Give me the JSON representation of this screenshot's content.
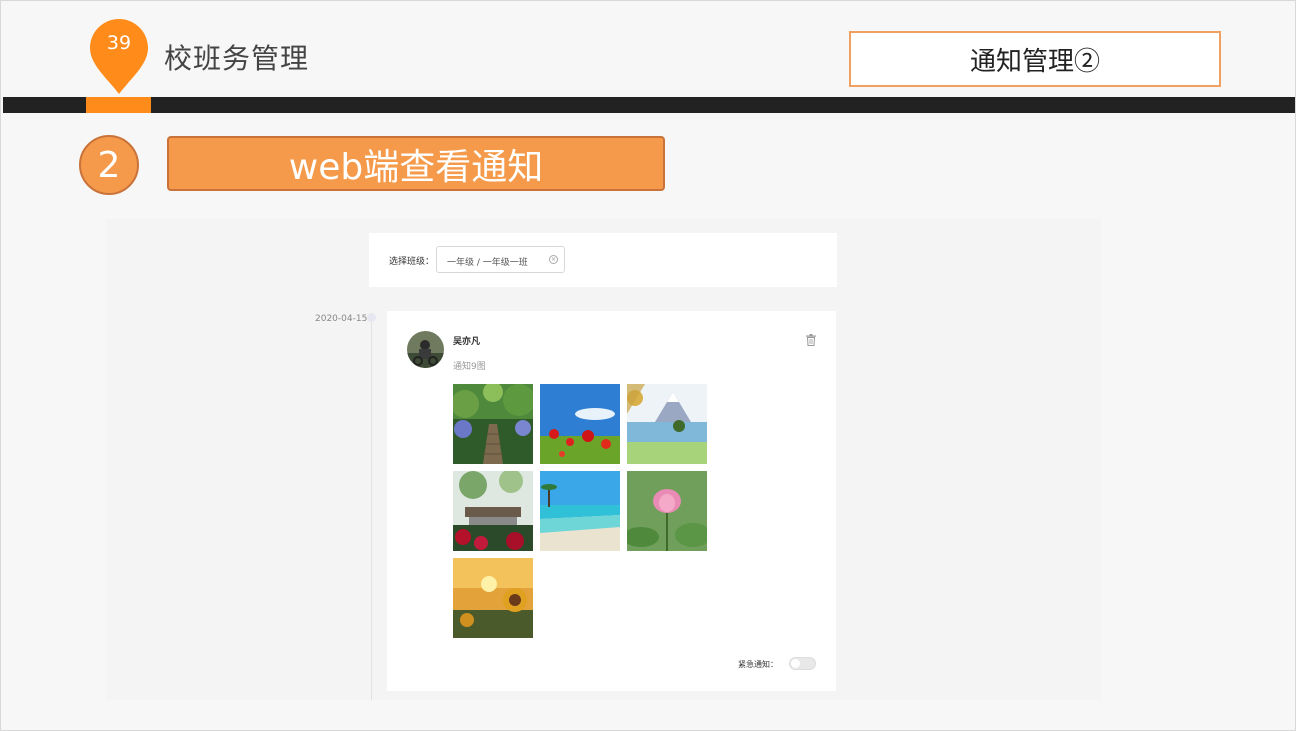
{
  "header": {
    "page_number": "39",
    "app_title": "校班务管理",
    "section_title": "通知管理②",
    "accent_color": "#ff8c1a",
    "bar_color": "#222222"
  },
  "step": {
    "number": "2",
    "title": "web端查看通知",
    "color": "#f59a4a"
  },
  "web": {
    "filter": {
      "label": "选择班级：",
      "value": "一年级 / 一年级一班",
      "clear_icon": "clear-circle-icon"
    },
    "timeline": {
      "date": "2020-04-15"
    },
    "notice": {
      "author": "吴亦凡",
      "text": "通知9图",
      "delete_icon": "trash-icon",
      "images": [
        "forest-path-photo",
        "red-poppies-sky-photo",
        "snow-mountain-lake-photo",
        "garden-pavilion-photo",
        "tropical-beach-photo",
        "pink-lotus-photo",
        "sunflower-sunset-photo"
      ],
      "urgent_label": "紧急通知：",
      "urgent_on": false
    }
  }
}
